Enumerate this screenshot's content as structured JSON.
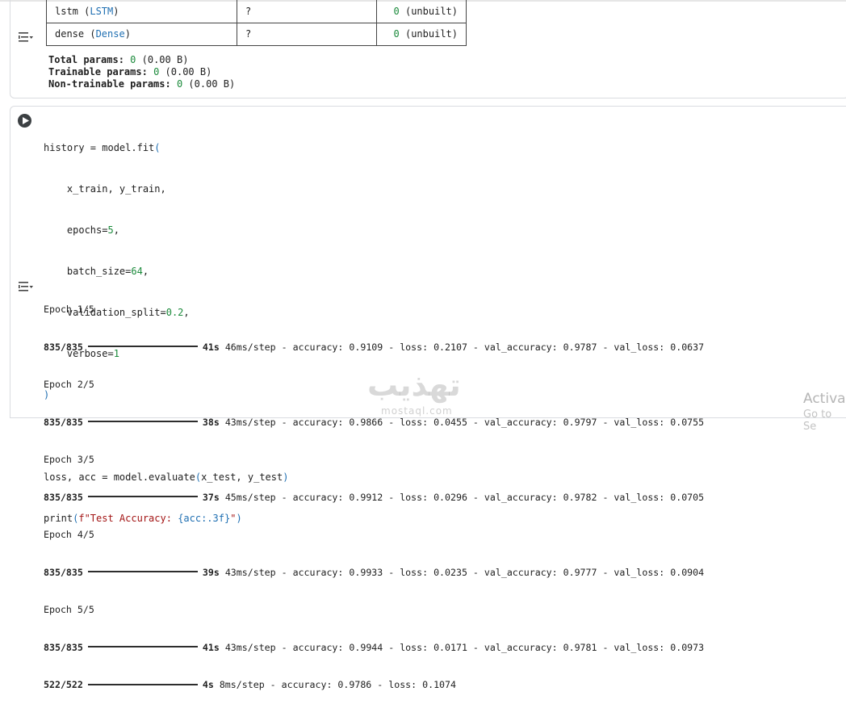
{
  "summary": {
    "rows": [
      {
        "name": "lstm",
        "type": "LSTM",
        "shape": "?",
        "params": "0",
        "params_note": "(unbuilt)"
      },
      {
        "name": "dense",
        "type": "Dense",
        "shape": "?",
        "params": "0",
        "params_note": "(unbuilt)"
      }
    ],
    "total_label": "Total params:",
    "total_value": "0",
    "total_size": "(0.00 B)",
    "trainable_label": "Trainable params:",
    "trainable_value": "0",
    "trainable_size": "(0.00 B)",
    "nontrainable_label": "Non-trainable params:",
    "nontrainable_value": "0",
    "nontrainable_size": "(0.00 B)"
  },
  "code": {
    "l1a": "history = model.fit",
    "l1b": "(",
    "l2": "    x_train, y_train,",
    "l3a": "    epochs=",
    "l3b": "5",
    "l3c": ",",
    "l4a": "    batch_size=",
    "l4b": "64",
    "l4c": ",",
    "l5a": "    validation_split=",
    "l5b": "0.2",
    "l5c": ",",
    "l6a": "    verbose=",
    "l6b": "1",
    "l7": ")",
    "l9a": "loss, acc = model.evaluate",
    "l9b": "(",
    "l9c": "x_test, y_test",
    "l9d": ")",
    "l10a": "print",
    "l10b": "(",
    "l10c": "f\"Test Accuracy: ",
    "l10d": "{acc:.3f}",
    "l10e": "\"",
    "l10f": ")"
  },
  "training": {
    "epochs": [
      {
        "label": "Epoch 1/5",
        "steps": "835/835",
        "time": "41s",
        "rest": "46ms/step - accuracy: 0.9109 - loss: 0.2107 - val_accuracy: 0.9787 - val_loss: 0.0637"
      },
      {
        "label": "Epoch 2/5",
        "steps": "835/835",
        "time": "38s",
        "rest": "43ms/step - accuracy: 0.9866 - loss: 0.0455 - val_accuracy: 0.9797 - val_loss: 0.0755"
      },
      {
        "label": "Epoch 3/5",
        "steps": "835/835",
        "time": "37s",
        "rest": "45ms/step - accuracy: 0.9912 - loss: 0.0296 - val_accuracy: 0.9782 - val_loss: 0.0705"
      },
      {
        "label": "Epoch 4/5",
        "steps": "835/835",
        "time": "39s",
        "rest": "43ms/step - accuracy: 0.9933 - loss: 0.0235 - val_accuracy: 0.9777 - val_loss: 0.0904"
      },
      {
        "label": "Epoch 5/5",
        "steps": "835/835",
        "time": "41s",
        "rest": "43ms/step - accuracy: 0.9944 - loss: 0.0171 - val_accuracy: 0.9781 - val_loss: 0.0973"
      }
    ],
    "eval": {
      "steps": "522/522",
      "time": "4s",
      "rest": "8ms/step - accuracy: 0.9786 - loss: 0.1074"
    }
  },
  "watermark": {
    "text": "تهذيب",
    "sub": "mostaql.com"
  },
  "activate": {
    "title": "Activa",
    "sub": "Go to Se"
  },
  "icons": {
    "output_toggle": "output-toggle-icon",
    "run": "play-icon"
  }
}
